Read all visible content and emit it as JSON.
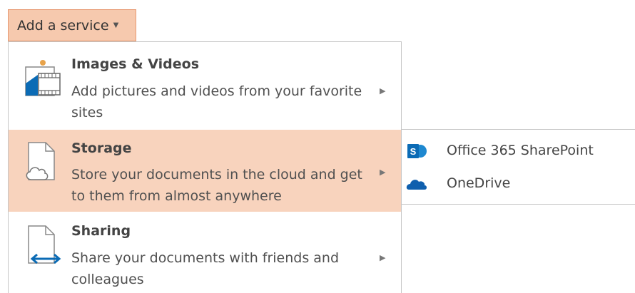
{
  "add_service": {
    "label": "Add a service",
    "caret_icon": "caret-down-icon"
  },
  "menu": {
    "items": [
      {
        "title": "Images & Videos",
        "description": "Add pictures and videos from your favorite sites",
        "icon": "images-videos-icon",
        "active": false
      },
      {
        "title": "Storage",
        "description": "Store your documents in the cloud and get to them from almost anywhere",
        "icon": "cloud-document-icon",
        "active": true
      },
      {
        "title": "Sharing",
        "description": "Share your documents with friends and colleagues",
        "icon": "share-document-icon",
        "active": false
      }
    ]
  },
  "submenu": {
    "items": [
      {
        "label": "Office 365 SharePoint",
        "icon": "sharepoint-icon"
      },
      {
        "label": "OneDrive",
        "icon": "onedrive-icon"
      }
    ]
  },
  "colors": {
    "button_bg": "#f6c9ae",
    "button_border": "#e79870",
    "active_bg": "#f8d3bd",
    "sharepoint_blue": "#0b6bb5",
    "onedrive_blue": "#0f5fae",
    "accent_orange": "#e8a34a"
  }
}
